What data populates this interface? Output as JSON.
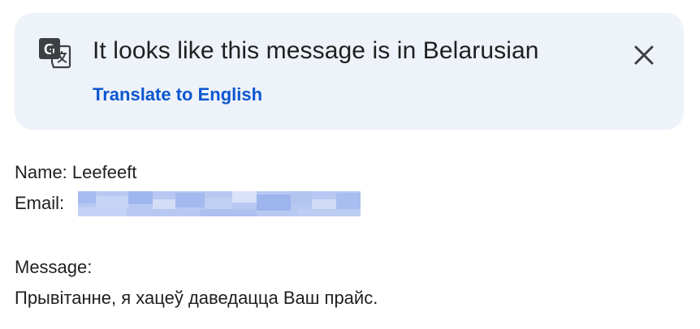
{
  "banner": {
    "icon": "translate-icon",
    "title": "It looks like this message is in Belarusian",
    "translate_link": "Translate to English",
    "close_icon": "close-icon"
  },
  "message": {
    "name_line": "Name: Leefeeft",
    "email_label": "Email:",
    "email_redacted": true,
    "message_label": "Message:",
    "message_text": "Прывітанне, я хацеў даведацца Ваш прайс."
  },
  "colors": {
    "banner_bg": "#eef2f9",
    "link": "#0b57d0",
    "text": "#1f1f1f",
    "redaction": "#a9bff0"
  }
}
